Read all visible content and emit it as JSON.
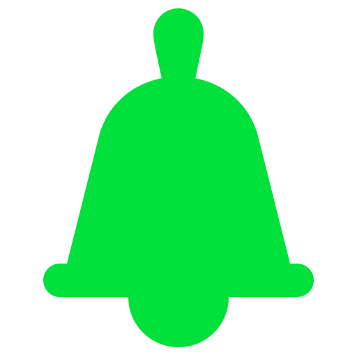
{
  "icon": {
    "name": "bell-icon",
    "color": "#00e03a",
    "background": "#ffffff"
  }
}
